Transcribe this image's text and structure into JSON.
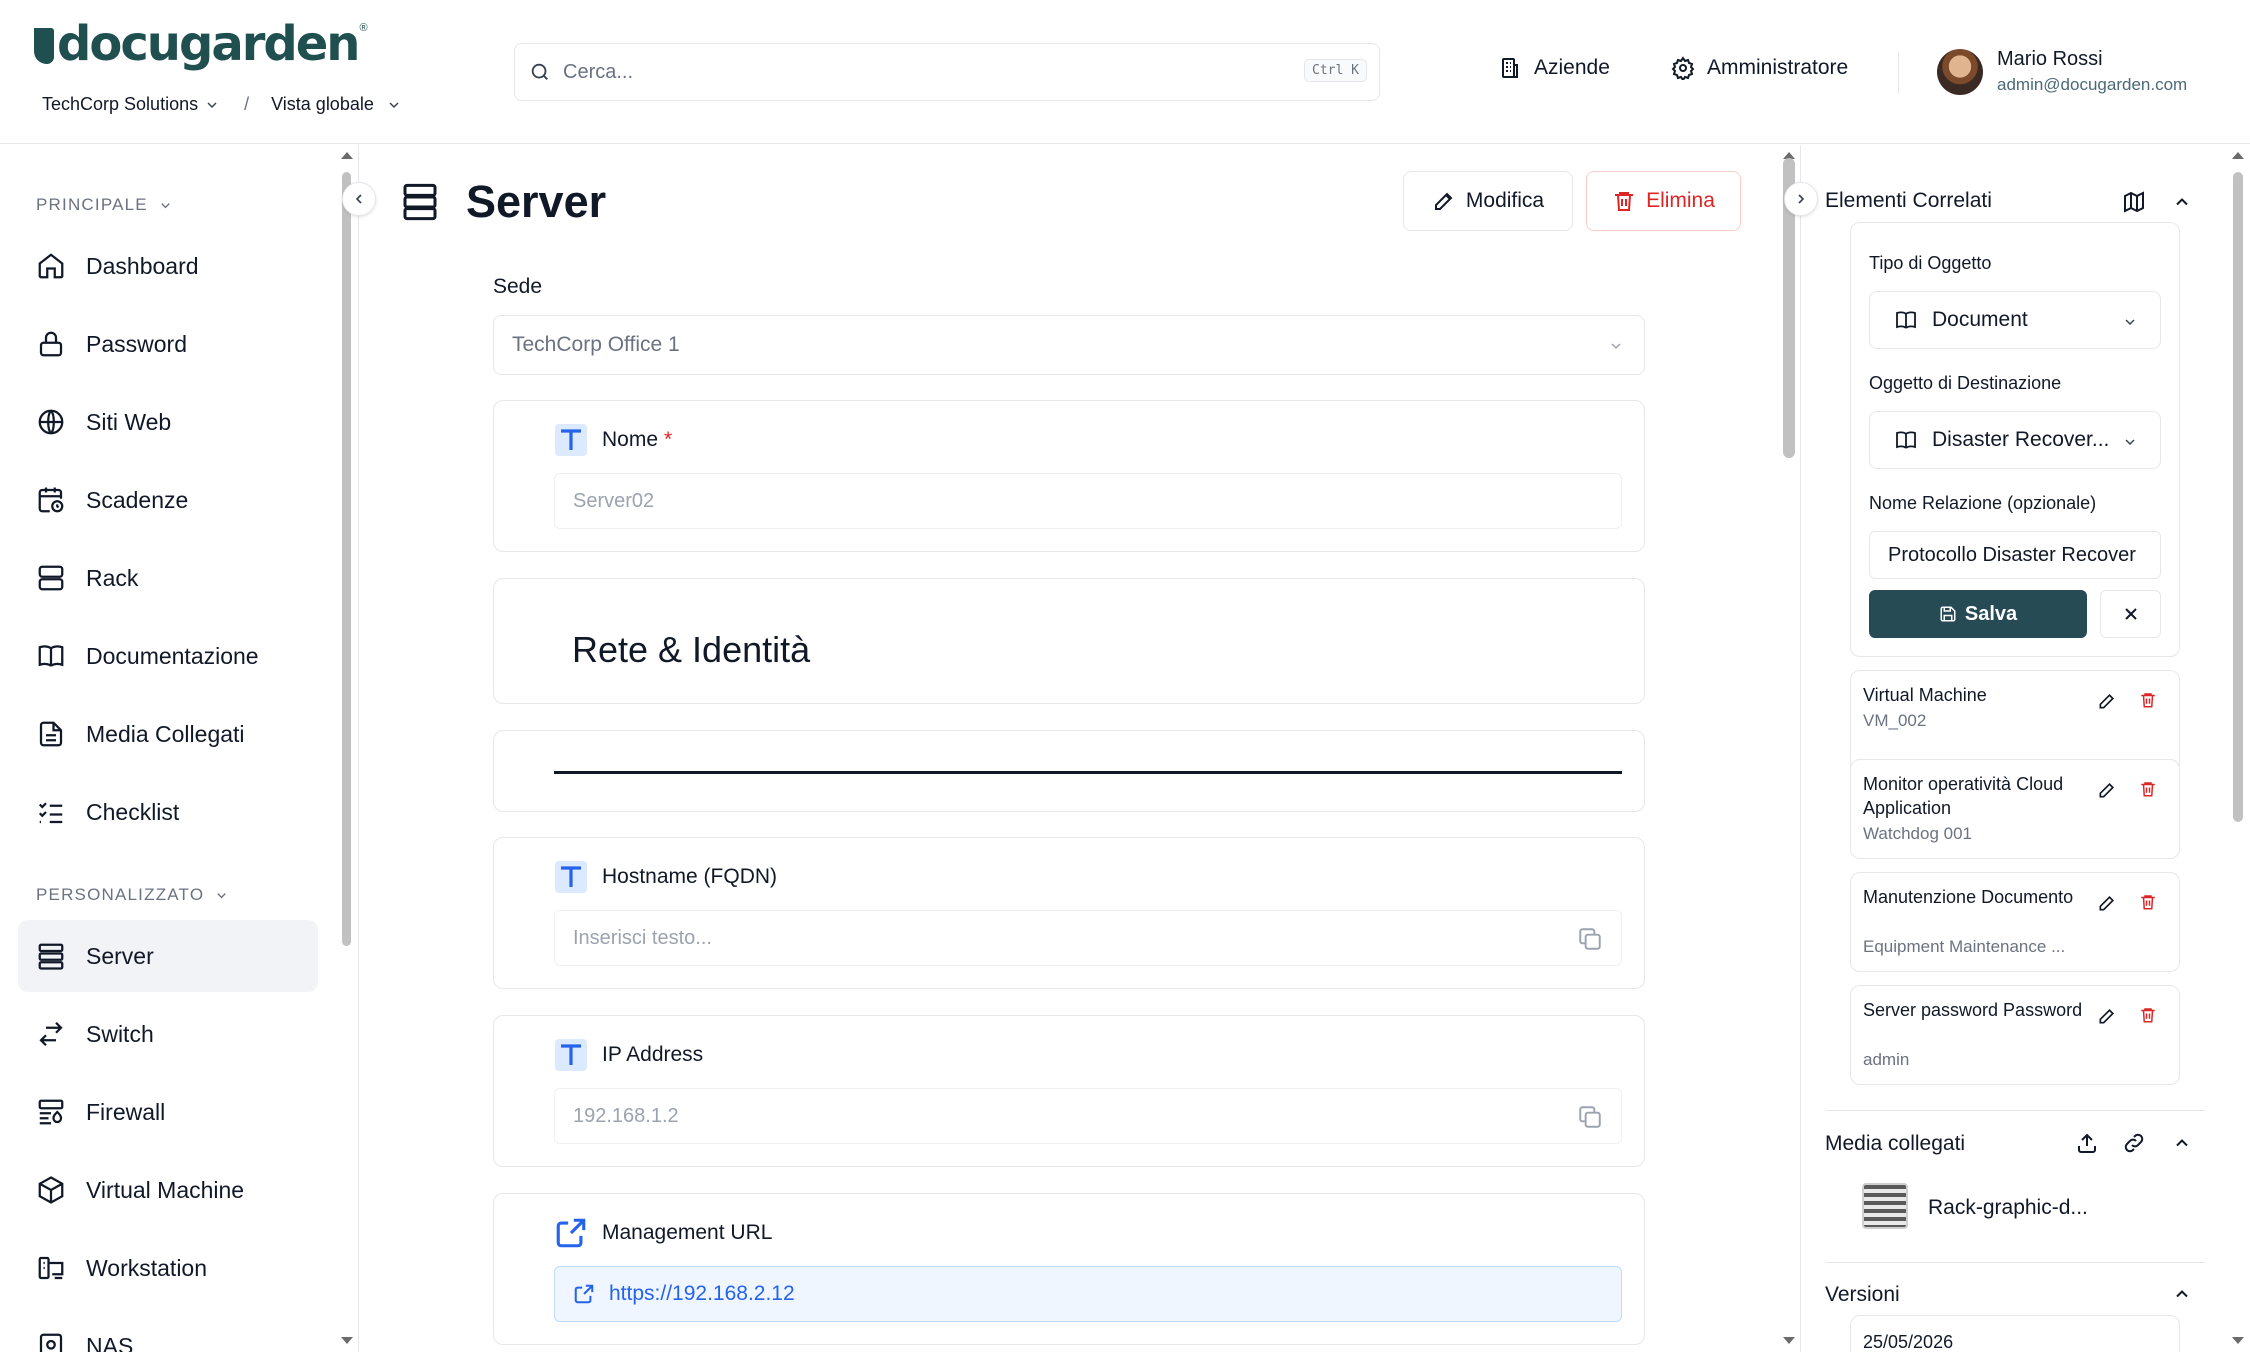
{
  "header": {
    "logo_text": "docugarden",
    "logo_reg": "®",
    "company": "TechCorp Solutions",
    "breadcrumb_sep": "/",
    "view": "Vista globale",
    "search_placeholder": "Cerca...",
    "search_shortcut": "Ctrl K",
    "companies_label": "Aziende",
    "admin_label": "Amministratore",
    "user_name": "Mario Rossi",
    "user_email": "admin@docugarden.com"
  },
  "sidebar": {
    "section_main": "PRINCIPALE",
    "main_items": [
      {
        "label": "Dashboard",
        "icon": "home-icon"
      },
      {
        "label": "Password",
        "icon": "lock-icon"
      },
      {
        "label": "Siti Web",
        "icon": "globe-icon"
      },
      {
        "label": "Scadenze",
        "icon": "calendar-clock-icon"
      },
      {
        "label": "Rack",
        "icon": "server-icon"
      },
      {
        "label": "Documentazione",
        "icon": "book-icon"
      },
      {
        "label": "Media Collegati",
        "icon": "file-icon"
      },
      {
        "label": "Checklist",
        "icon": "checklist-icon"
      }
    ],
    "section_custom": "PERSONALIZZATO",
    "custom_items": [
      {
        "label": "Server",
        "icon": "server-icon",
        "active": true
      },
      {
        "label": "Switch",
        "icon": "switch-icon"
      },
      {
        "label": "Firewall",
        "icon": "firewall-icon"
      },
      {
        "label": "Virtual Machine",
        "icon": "box-icon"
      },
      {
        "label": "Workstation",
        "icon": "workstation-icon"
      },
      {
        "label": "NAS",
        "icon": "nas-icon"
      }
    ]
  },
  "main": {
    "title": "Server",
    "edit_label": "Modifica",
    "delete_label": "Elimina",
    "site_label": "Sede",
    "site_value": "TechCorp Office 1",
    "name_label": "Nome",
    "name_required": "*",
    "name_value": "Server02",
    "section_title": "Rete & Identità",
    "hostname_label": "Hostname (FQDN)",
    "hostname_placeholder": "Inserisci testo...",
    "ip_label": "IP Address",
    "ip_value": "192.168.1.2",
    "url_label": "Management URL",
    "url_value": "https://192.168.2.12"
  },
  "related": {
    "title": "Elementi Correlati",
    "type_label": "Tipo di Oggetto",
    "type_value": "Document",
    "target_label": "Oggetto di Destinazione",
    "target_value": "Disaster Recover...",
    "relation_label": "Nome Relazione (opzionale)",
    "relation_value": "Protocollo Disaster Recover",
    "save_label": "Salva",
    "items": [
      {
        "title": "Virtual Machine",
        "subtitle": "VM_002"
      },
      {
        "title": "Monitor operatività Cloud Application",
        "subtitle": "Watchdog 001"
      },
      {
        "title": "Manutenzione Documento",
        "subtitle": "Equipment Maintenance ..."
      },
      {
        "title": "Server password Password",
        "subtitle": "admin"
      }
    ]
  },
  "media": {
    "title": "Media collegati",
    "file_name": "Rack-graphic-d..."
  },
  "versions": {
    "title": "Versioni",
    "first_date": "25/05/2026"
  },
  "colors": {
    "brand": "#1f4f4f",
    "primary_button": "#264b55",
    "danger": "#dc2626",
    "link": "#2563eb",
    "field_icon": "#2563eb"
  }
}
